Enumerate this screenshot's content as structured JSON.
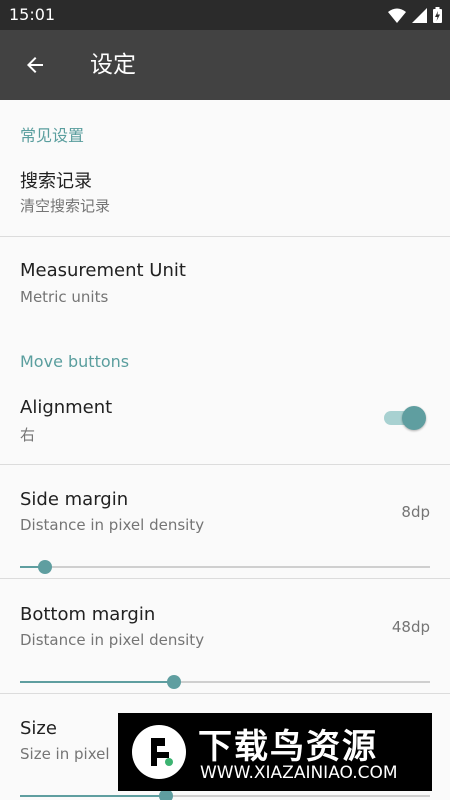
{
  "status_bar": {
    "time": "15:01",
    "icons": [
      "wifi-icon",
      "signal-icon",
      "battery-icon"
    ]
  },
  "app_bar": {
    "title": "设定",
    "back_icon": "arrow-back-icon"
  },
  "sections": {
    "general": {
      "header": "常见设置"
    },
    "move_buttons": {
      "header": "Move buttons"
    }
  },
  "prefs": {
    "search_history": {
      "title": "搜索记录",
      "summary": "清空搜索记录"
    },
    "measurement_unit": {
      "title": "Measurement Unit",
      "summary": "Metric units"
    },
    "alignment": {
      "title": "Alignment",
      "summary": "右",
      "enabled": true
    },
    "side_margin": {
      "title": "Side margin",
      "summary": "Distance in pixel density",
      "value": "8dp",
      "fraction": 0.06
    },
    "bottom_margin": {
      "title": "Bottom margin",
      "summary": "Distance in pixel density",
      "value": "48dp",
      "fraction": 0.375
    },
    "size": {
      "title": "Size",
      "summary": "Size in pixel",
      "fraction": 0.355
    }
  },
  "watermark": {
    "text": "下载鸟资源",
    "url": "WWW.XIAZAINIAO.COM"
  },
  "colors": {
    "accent": "#5f9ea0",
    "app_bar": "#424242",
    "status_bar": "#2b2b2b"
  }
}
